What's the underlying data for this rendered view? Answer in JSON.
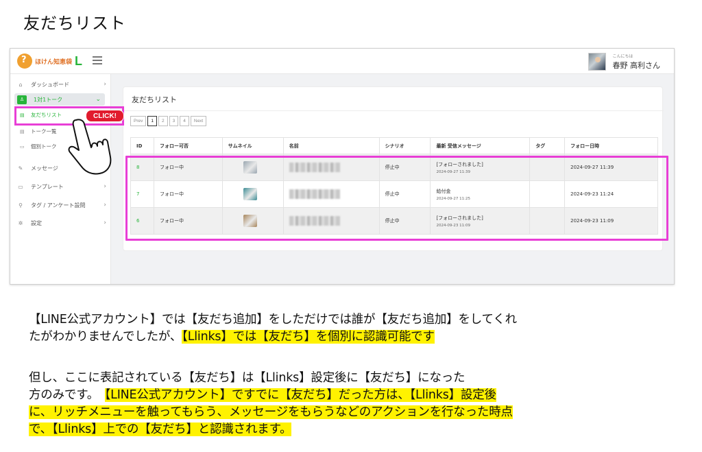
{
  "page_title": "友だちリスト",
  "app": {
    "brand_text": "ほけん知恵袋",
    "brand_mark": "L",
    "user_greeting": "こんにちは",
    "user_name": "春野 高利さん"
  },
  "sidebar": {
    "items": [
      {
        "icon": "home-icon",
        "label": "ダッシュボード"
      },
      {
        "icon": "user-icon",
        "label": "1対1トーク"
      },
      {
        "icon": "message-icon",
        "label": "メッセージ"
      },
      {
        "icon": "template-icon",
        "label": "テンプレート"
      },
      {
        "icon": "tag-icon",
        "label": "タグ / アンケート設問"
      },
      {
        "icon": "gear-icon",
        "label": "設定"
      }
    ],
    "sub_items": [
      {
        "icon": "list-icon",
        "label": "友だちリスト"
      },
      {
        "icon": "list-icon",
        "label": "トーク一覧"
      },
      {
        "icon": "chat-icon",
        "label": "個別トーク"
      }
    ]
  },
  "callout": {
    "click_label": "CLICK!"
  },
  "main": {
    "card_title": "友だちリスト",
    "pager": {
      "prev": "Prev",
      "pages": [
        "1",
        "2",
        "3",
        "4"
      ],
      "current": "1",
      "next": "Next"
    },
    "columns": [
      "ID",
      "フォロー可否",
      "サムネイル",
      "名前",
      "シナリオ",
      "最新 受信メッセージ",
      "タグ",
      "フォロー日時"
    ],
    "rows": [
      {
        "id": "8",
        "follow": "フォロー中",
        "thumb_color": "#9aa6b0",
        "scenario": "停止中",
        "msg": "[フォローされました]",
        "msg_time": "2024-09-27 11:39",
        "tag": "",
        "followed_at": "2024-09-27 11:39"
      },
      {
        "id": "7",
        "follow": "フォロー中",
        "thumb_color": "#3d8d95",
        "scenario": "停止中",
        "msg": "給付金",
        "msg_time": "2024-09-27 11:25",
        "tag": "",
        "followed_at": "2024-09-23 11:24"
      },
      {
        "id": "6",
        "follow": "フォロー中",
        "thumb_color": "#a8865c",
        "scenario": "停止中",
        "msg": "[フォローされました]",
        "msg_time": "2024-09-23 11:09",
        "tag": "",
        "followed_at": "2024-09-23 11:09"
      }
    ]
  },
  "explanation": {
    "p1_line1": "【LINE公式アカウント】では【友だち追加】をしただけでは誰が【友だち追加】をしてくれ",
    "p1_line2_plain": "たがわかりませんでしたが、",
    "p1_line2_hl": "【Llinks】では【友だち】を個別に認識可能です",
    "p2_line1": "但し、ここに表記されている【友だち】は【Llinks】設定後に【友だち】になった",
    "p2_line2_plain": "方のみです。　",
    "p2_line2_hl": "【LINE公式アカウント】ですでに【友だち】だった方は、【Llinks】設定後",
    "p2_line3_hl": "に、リッチメニューを触ってもらう、メッセージをもらうなどのアクションを行なった時点",
    "p2_line4_hl": "で、【Llinks】上での【友だち】と認識されます。"
  },
  "colors": {
    "accent": "#27b43a",
    "highlight_frame": "#e83ed6",
    "click_badge": "#e11b2e",
    "text_highlight": "#fff200"
  }
}
